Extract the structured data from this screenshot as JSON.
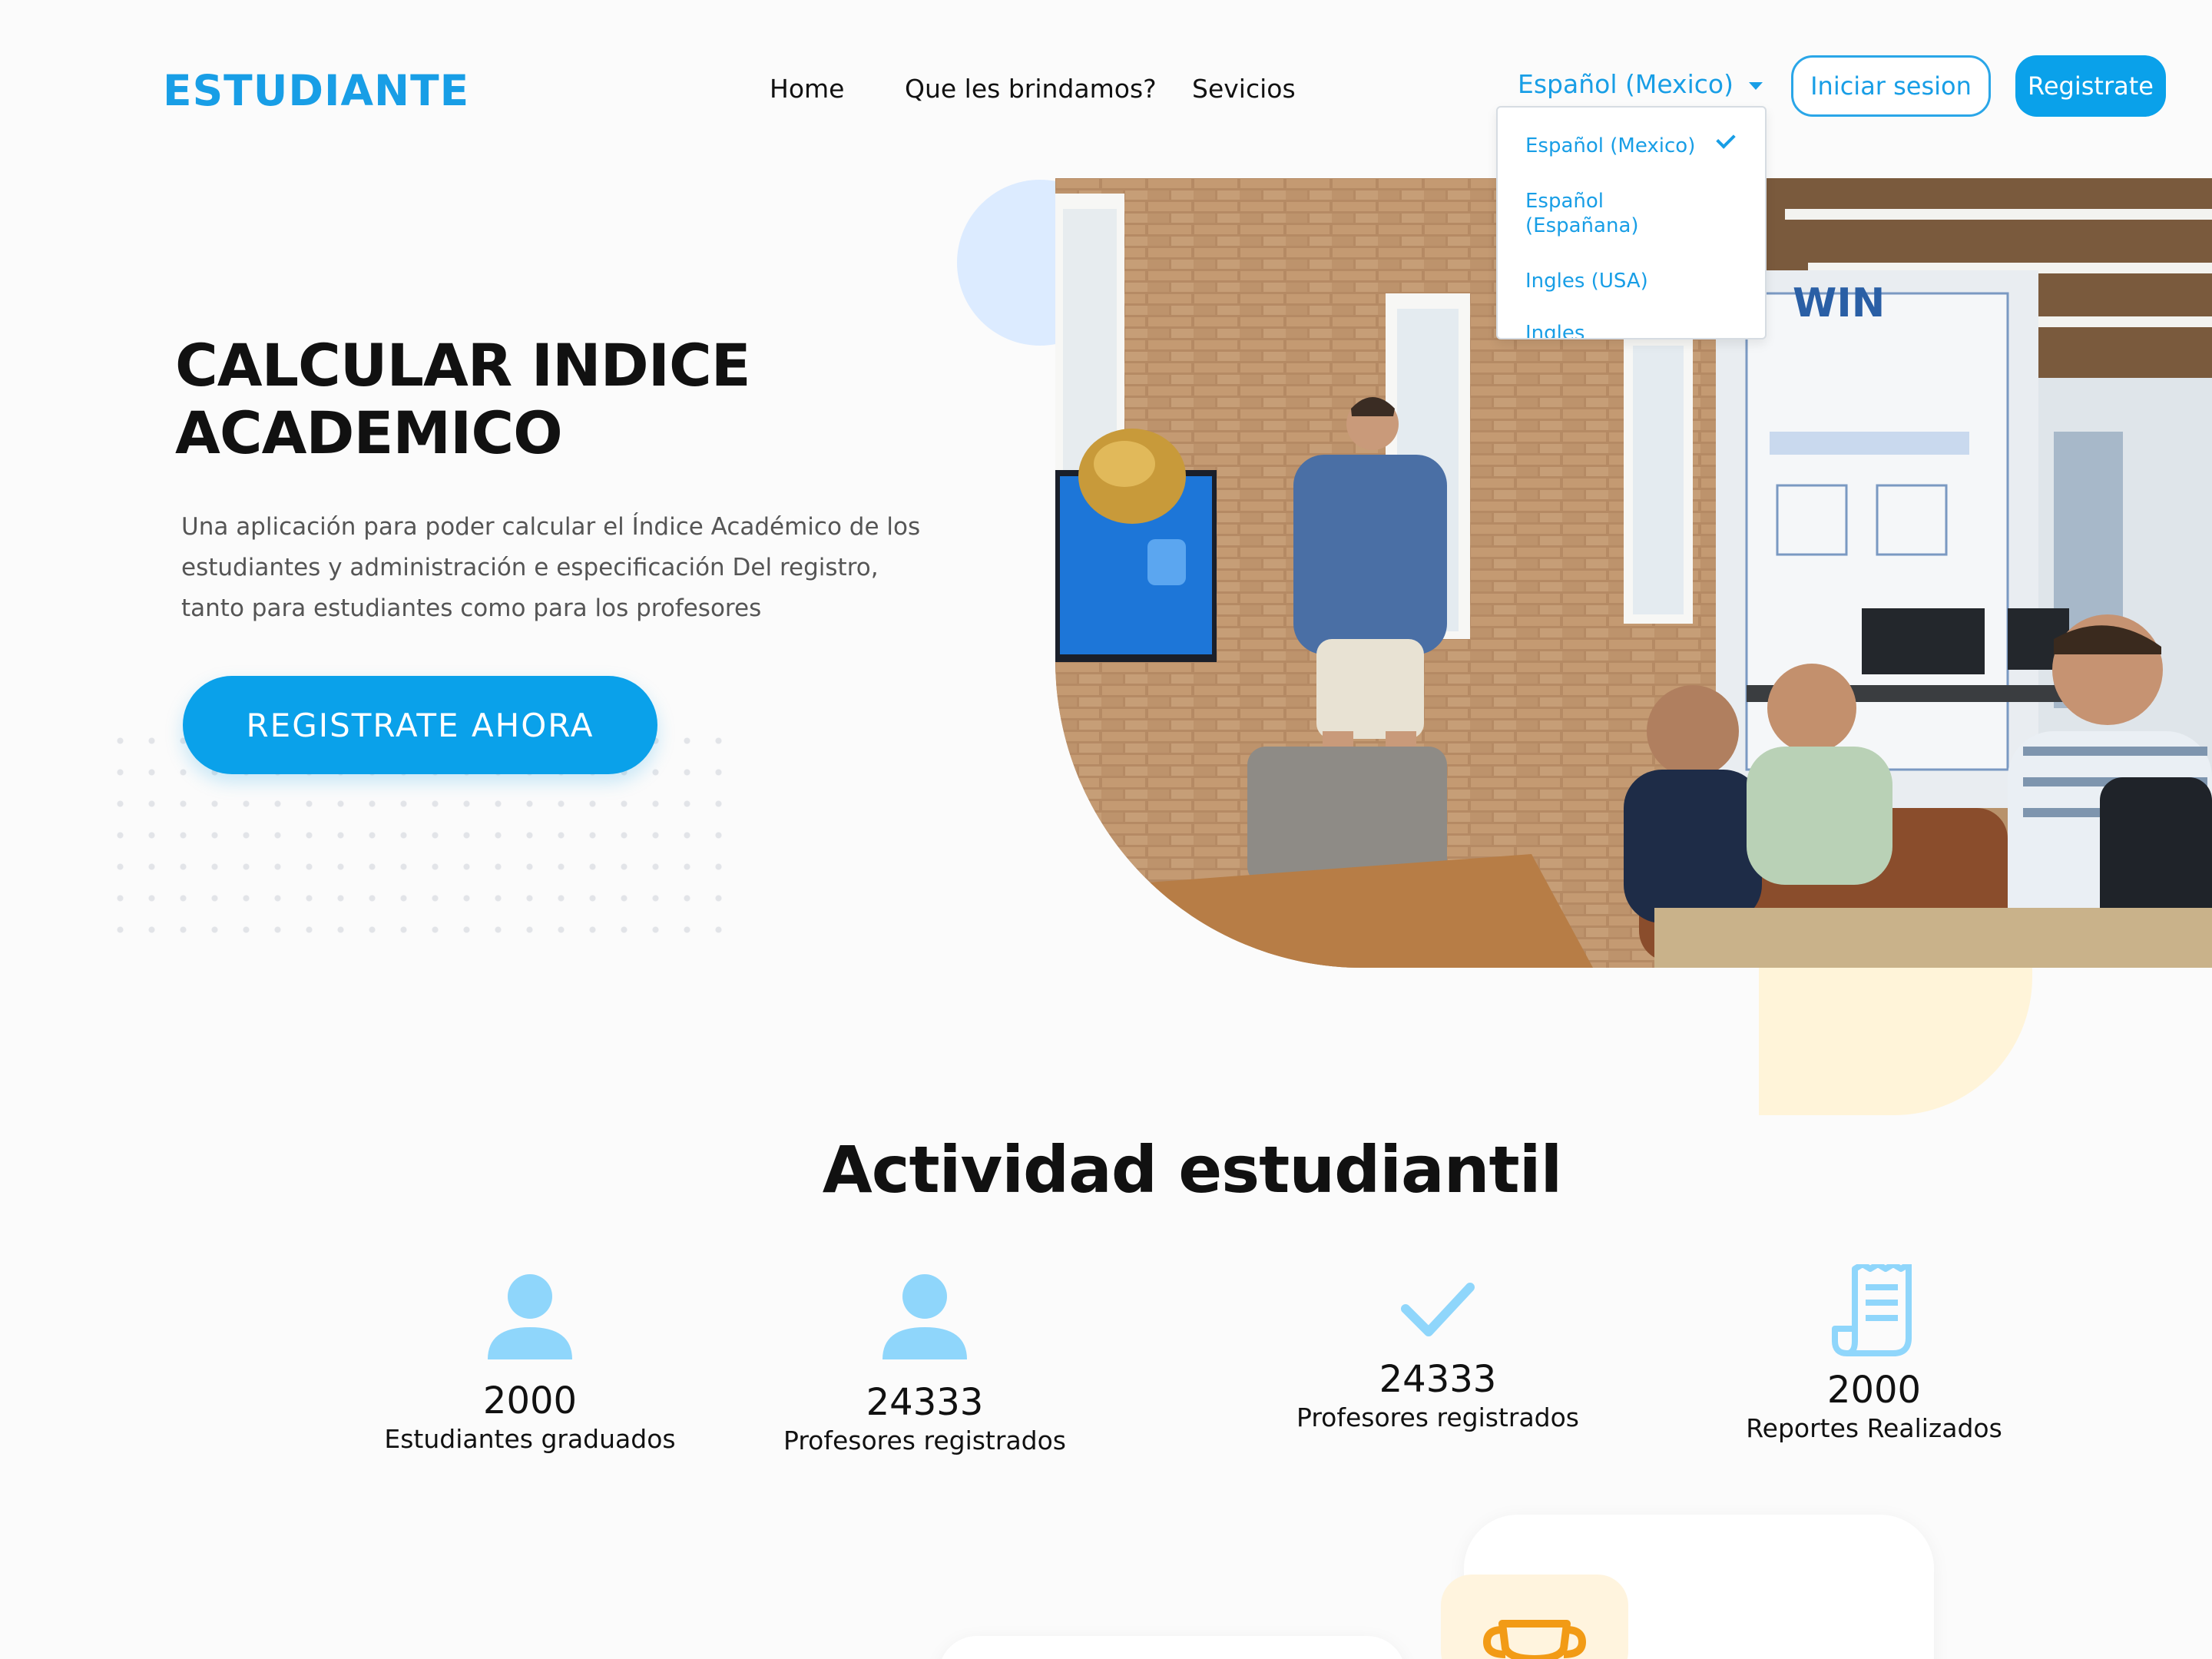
{
  "brand": {
    "logo": "ESTUDIANTE",
    "accent_color": "#0aa1ea"
  },
  "nav": {
    "links": [
      "Home",
      "Que les brindamos?",
      "Sevicios"
    ],
    "language": {
      "selected": "Español (Mexico)",
      "options": [
        "Español (Mexico)",
        "Español (Españana)",
        "Ingles (USA)",
        "Ingles (CANADA)"
      ]
    },
    "login_label": "Iniciar sesion",
    "register_label": "Registrate"
  },
  "hero": {
    "title_line1": "CALCULAR INDICE",
    "title_line2": "ACADEMICO",
    "description": "Una aplicación para poder calcular el Índice Académico de los estudiantes y administración e especificación Del registro, tanto para estudiantes como para los profesores",
    "cta_label": "REGISTRATE AHORA"
  },
  "stats": {
    "title": "Actividad estudiantil",
    "items": [
      {
        "icon": "user-icon",
        "value": "2000",
        "label": "Estudiantes graduados"
      },
      {
        "icon": "user-icon",
        "value": "24333",
        "label": "Profesores registrados"
      },
      {
        "icon": "check-icon",
        "value": "24333",
        "label": "Profesores registrados"
      },
      {
        "icon": "report-icon",
        "value": "2000",
        "label": "Reportes Realizados"
      }
    ]
  },
  "cards": {
    "trophy_icon": "trophy-icon"
  }
}
